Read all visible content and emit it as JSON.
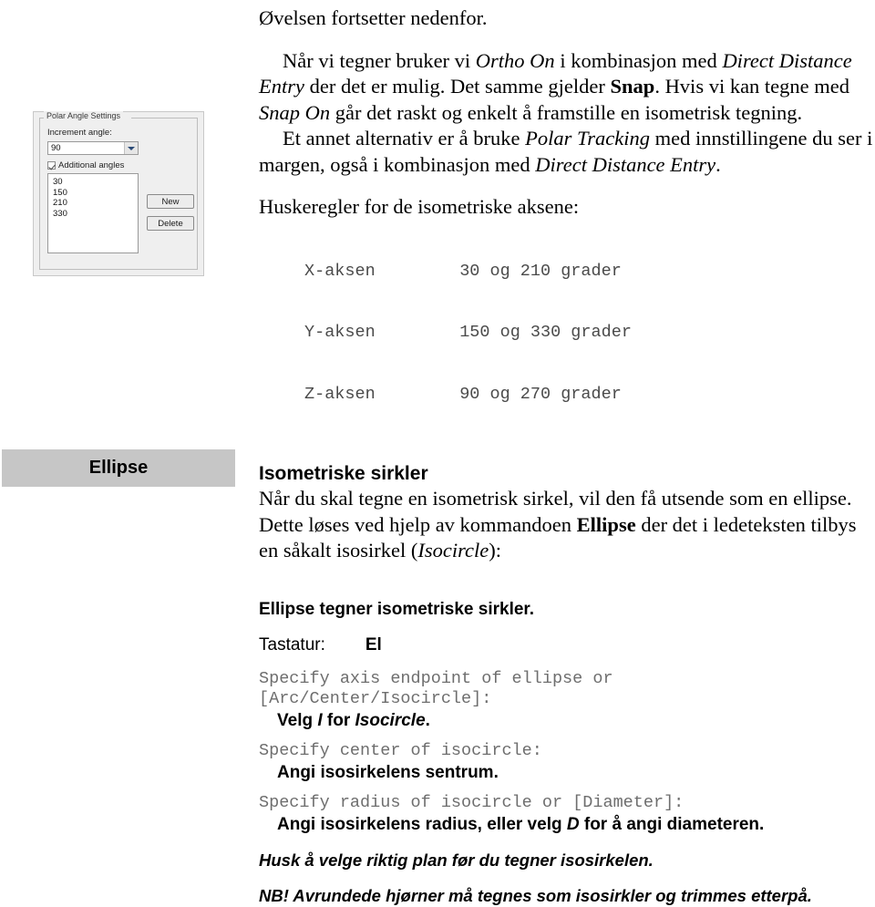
{
  "margin_figure": {
    "group_title": "Polar Angle Settings",
    "increment_label": "Increment angle:",
    "increment_value": "90",
    "checkbox_label": "Additional angles",
    "angles": [
      "30",
      "150",
      "210",
      "330"
    ],
    "new_button": "New",
    "delete_button": "Delete"
  },
  "command_band": {
    "label": "Ellipse"
  },
  "body": {
    "intro": "Øvelsen fortsetter nedenfor.",
    "para1": {
      "s1": "Når vi tegner bruker vi ",
      "i1": "Ortho On",
      "s2": " i kombinasjon med ",
      "i2": "Direct Distance Entry",
      "s3": " der det er mulig. Det samme gjelder ",
      "b1": "Snap",
      "s4": ". Hvis vi kan tegne med ",
      "i3": "Snap On",
      "s5": " går det raskt og enkelt å framstille en isometrisk tegning."
    },
    "para2": {
      "s1": "Et annet alternativ er å bruke ",
      "i1": "Polar Tracking",
      "s2": " med innstillingene du ser i margen, også i kombinasjon med ",
      "i2": "Direct Distance Entry",
      "s3": "."
    },
    "axes_heading": "Huskeregler for de isometriske aksene:",
    "axes_rows": [
      {
        "axis": "X-aksen",
        "degrees": "30 og 210 grader"
      },
      {
        "axis": "Y-aksen",
        "degrees": "150 og 330 grader"
      },
      {
        "axis": "Z-aksen",
        "degrees": "90 og 270 grader"
      }
    ],
    "iso_heading": "Isometriske sirkler",
    "iso_para": {
      "s1": "Når du skal tegne en isometrisk sirkel, vil den få utsende som en ellipse. Dette løses ved hjelp av kommandoen ",
      "b1": "Ellipse",
      "s2": " der det i ledeteksten tilbys en såkalt isosirkel (",
      "i1": "Isocircle",
      "s3": "):"
    },
    "cmd_title": "Ellipse tegner isometriske sirkler.",
    "keyboard_label": "Tastatur:",
    "keyboard_value": "El",
    "prompt1_line1": "Specify axis endpoint of ellipse or",
    "prompt1_line2": "[Arc/Center/Isocircle]:",
    "answer1": {
      "s1": "Velg ",
      "i1": "I",
      "s2": " for ",
      "i2": "Isocircle",
      "s3": "."
    },
    "prompt2": "Specify center of isocircle:",
    "answer2": "Angi isosirkelens sentrum.",
    "prompt3": "Specify radius of isocircle or [Diameter]:",
    "answer3": {
      "s1": "Angi isosirkelens radius, eller velg ",
      "i1": "D",
      "s2": " for å angi diameteren."
    },
    "note1": "Husk å velge riktig plan før du tegner isosirkelen.",
    "note2": "NB! Avrundede hjørner må tegnes som isosirkler og trimmes etterpå."
  }
}
